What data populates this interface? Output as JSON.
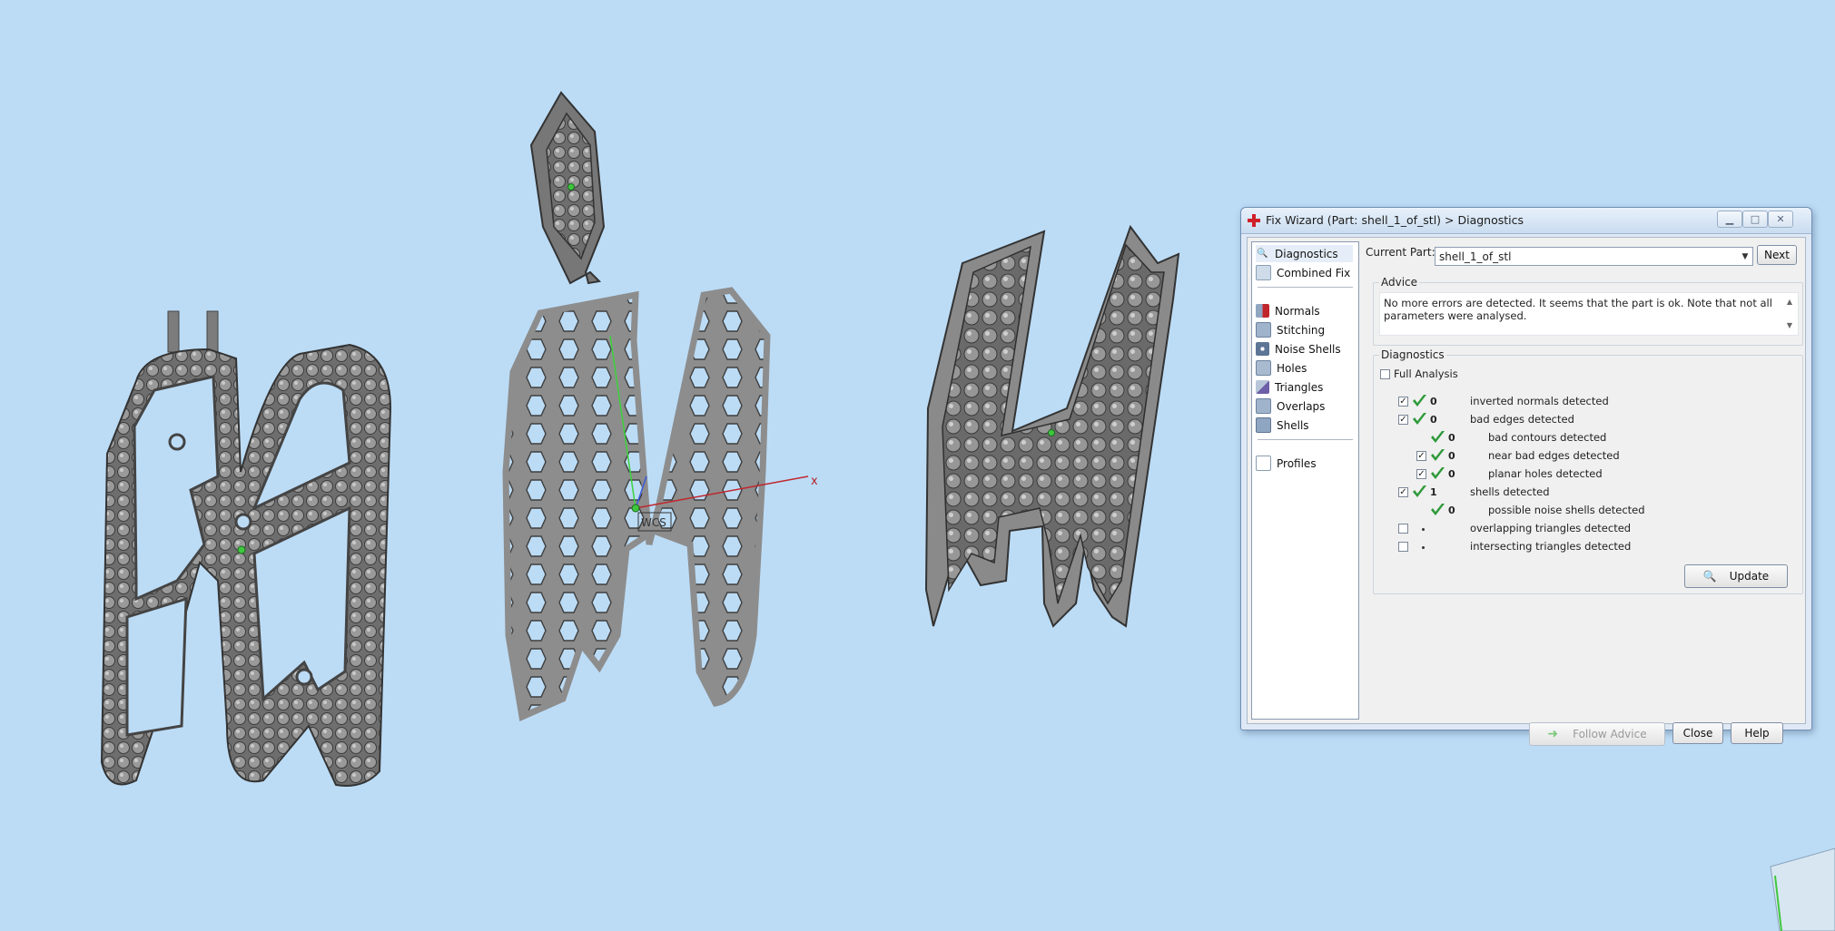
{
  "viewport": {
    "background": "#bcdcf6",
    "axis_x_label": "x",
    "wcs_label": "WCS"
  },
  "dialog": {
    "title": "Fix Wizard (Part: shell_1_of_stl) > Diagnostics",
    "nav": [
      {
        "label": "Diagnostics",
        "icon": "magnifier-icon",
        "selected": true
      },
      {
        "label": "Combined Fix",
        "icon": "combined-fix-icon"
      },
      {
        "label": "Normals",
        "icon": "normals-icon"
      },
      {
        "label": "Stitching",
        "icon": "stitching-icon"
      },
      {
        "label": "Noise Shells",
        "icon": "noise-shells-icon"
      },
      {
        "label": "Holes",
        "icon": "holes-icon"
      },
      {
        "label": "Triangles",
        "icon": "triangles-icon"
      },
      {
        "label": "Overlaps",
        "icon": "overlaps-icon"
      },
      {
        "label": "Shells",
        "icon": "shells-icon"
      },
      {
        "label": "Profiles",
        "icon": "profiles-icon"
      }
    ],
    "current_part_label": "Current Part:",
    "current_part_value": "shell_1_of_stl",
    "next_button": "Next",
    "advice_title": "Advice",
    "advice_text": "No more errors are detected. It seems that the part is ok. Note that not all parameters were analysed.",
    "diagnostics_title": "Diagnostics",
    "full_analysis_label": "Full Analysis",
    "full_analysis_checked": false,
    "rows": [
      {
        "checkbox": true,
        "checked": true,
        "status": "ok",
        "count": "0",
        "label": "inverted normals detected",
        "indent": 0
      },
      {
        "checkbox": true,
        "checked": true,
        "status": "ok",
        "count": "0",
        "label": "bad edges detected",
        "indent": 0
      },
      {
        "checkbox": false,
        "checked": false,
        "status": "ok",
        "count": "0",
        "label": "bad contours detected",
        "indent": 1
      },
      {
        "checkbox": true,
        "checked": true,
        "status": "ok",
        "count": "0",
        "label": "near bad edges detected",
        "indent": 1
      },
      {
        "checkbox": true,
        "checked": true,
        "status": "ok",
        "count": "0",
        "label": "planar holes detected",
        "indent": 1
      },
      {
        "checkbox": true,
        "checked": true,
        "status": "ok",
        "count": "1",
        "label": "shells detected",
        "indent": 0
      },
      {
        "checkbox": false,
        "checked": false,
        "status": "ok",
        "count": "0",
        "label": "possible noise shells detected",
        "indent": 1
      },
      {
        "checkbox": true,
        "checked": false,
        "status": "none",
        "count": "",
        "label": "overlapping triangles detected",
        "indent": 0
      },
      {
        "checkbox": true,
        "checked": false,
        "status": "none",
        "count": "",
        "label": "intersecting triangles detected",
        "indent": 0
      }
    ],
    "update_button": "Update",
    "follow_advice_button": "Follow Advice",
    "close_button": "Close",
    "help_button": "Help",
    "colors": {
      "ok_tick": "#2e9a3a",
      "accent": "#6f8fb5"
    }
  }
}
